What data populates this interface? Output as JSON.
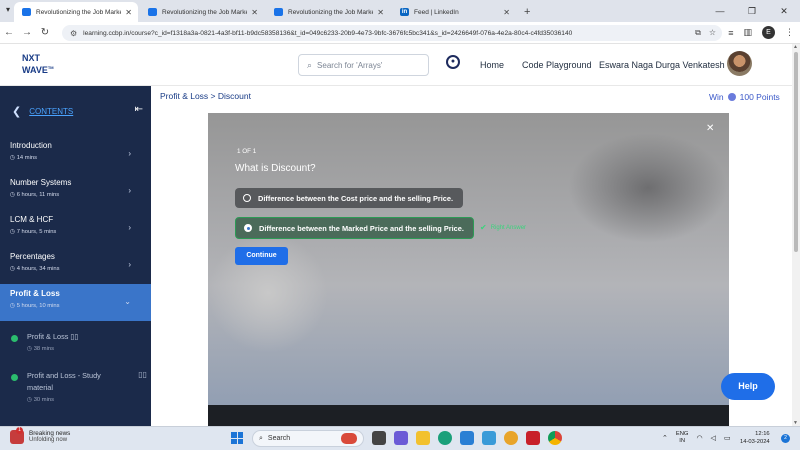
{
  "browser": {
    "tabs": [
      {
        "label": "Revolutionizing the Job Market",
        "active": true
      },
      {
        "label": "Revolutionizing the Job Market",
        "active": false
      },
      {
        "label": "Revolutionizing the Job Market",
        "active": false
      },
      {
        "label": "Feed | LinkedIn",
        "active": false
      }
    ],
    "new_tab": "+",
    "url": "learning.ccbp.in/course?c_id=f1318a3a-0821-4a3f-bf11-b9dc58358136&t_id=049c6233-20b9-4e73-9bfc-3676fc5bc341&s_id=2426649f-076a-4e2a-80c4-c4fd35036140",
    "profile_initial": "E"
  },
  "header": {
    "logo_line1": "NXT",
    "logo_line2": "WAVE",
    "logo_tm": "TM",
    "search_placeholder": "Search for 'Arrays'",
    "nav_home": "Home",
    "nav_code": "Code Playground",
    "username": "Eswara Naga Durga Venkatesh"
  },
  "sidebar": {
    "title": "CONTENTS",
    "topics": [
      {
        "name": "Introduction",
        "duration": "14 mins"
      },
      {
        "name": "Number Systems",
        "duration": "6 hours, 11 mins"
      },
      {
        "name": "LCM & HCF",
        "duration": "7 hours, 5 mins"
      },
      {
        "name": "Percentages",
        "duration": "4 hours, 34 mins"
      },
      {
        "name": "Profit & Loss",
        "duration": "5 hours, 10 mins"
      }
    ],
    "sub_items": [
      {
        "name": "Profit & Loss",
        "duration": "38 mins"
      },
      {
        "name": "Profit and Loss - Study material",
        "duration": "30 mins"
      }
    ]
  },
  "main": {
    "breadcrumb": "Profit & Loss > Discount",
    "win_label": "Win",
    "win_points": "100 Points"
  },
  "quiz": {
    "count": "1 OF 1",
    "question": "What is Discount?",
    "options": [
      "Difference between the Cost price and the selling Price.",
      "Difference between the Marked Price and the selling Price."
    ],
    "selected_option": 2,
    "feedback": "Right Answer",
    "continue_label": "Continue"
  },
  "help_label": "Help",
  "taskbar": {
    "news_title": "Breaking news",
    "news_sub": "Unfolding now",
    "news_badge": "1",
    "search_label": "Search",
    "lang1": "ENG",
    "lang2": "IN",
    "time": "12:16",
    "date": "14-03-2024",
    "notif_count": "2"
  },
  "colors": {
    "sidebar_bg": "#1b2a4a",
    "sidebar_active": "#3a75c9",
    "accent_blue": "#1f6ee8",
    "correct_green": "#2c9b55"
  }
}
